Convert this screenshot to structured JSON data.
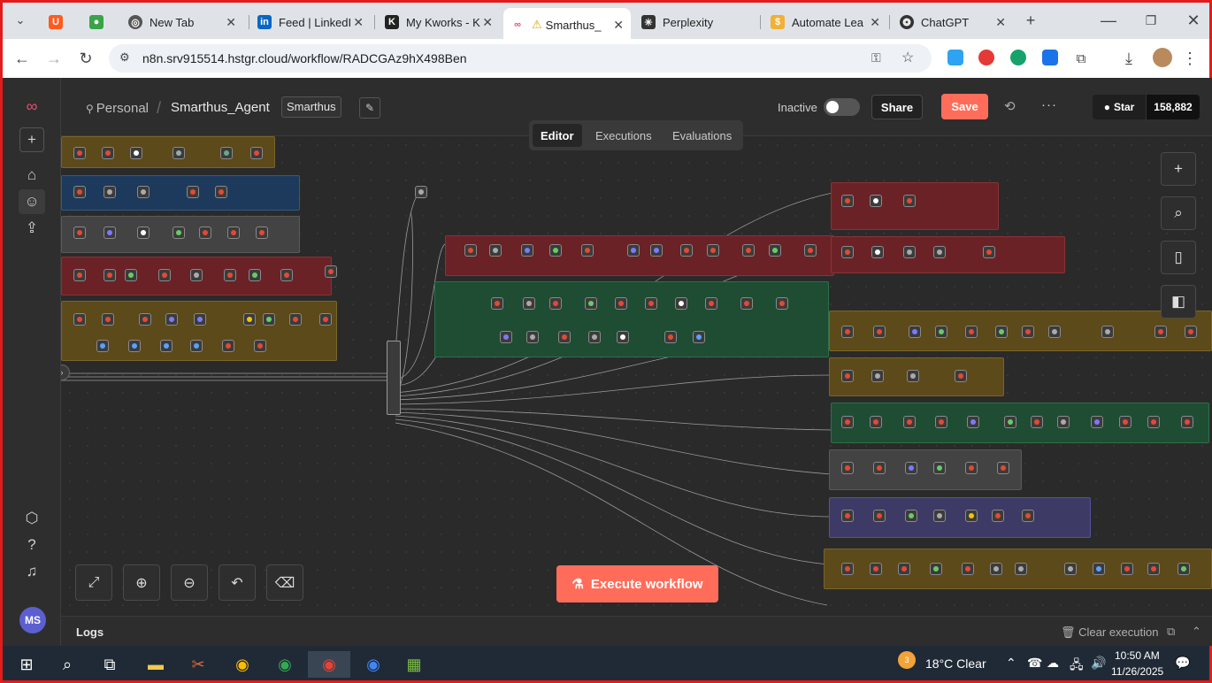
{
  "browser": {
    "tabs": [
      {
        "label": "",
        "icon": "ublock-icon"
      },
      {
        "label": "",
        "icon": "globe-icon"
      },
      {
        "label": "New Tab",
        "icon": "chrome-icon"
      },
      {
        "label": "Feed | LinkedI",
        "icon": "linkedin-icon"
      },
      {
        "label": "My Kworks - K",
        "icon": "kwork-icon"
      },
      {
        "label": "Smarthus_",
        "icon": "n8n-icon",
        "active": true
      },
      {
        "label": "Perplexity",
        "icon": "perplexity-icon"
      },
      {
        "label": "Automate Lea",
        "icon": "automation-icon"
      },
      {
        "label": "ChatGPT",
        "icon": "chatgpt-icon"
      }
    ],
    "url": "n8n.srv915514.hstgr.cloud/workflow/RADCGAz9hX498Ben"
  },
  "header": {
    "breadcrumb_home": "Personal",
    "separator": "/",
    "workflow_name": "Smarthus_Agent",
    "tag": "Smarthus",
    "status_label": "Inactive",
    "share_label": "Share",
    "save_label": "Save",
    "more_label": "···",
    "github_star_label": "Star",
    "github_star_count": "158,882"
  },
  "mode_tabs": [
    "Editor",
    "Executions",
    "Evaluations"
  ],
  "canvas": {
    "execute_label": "Execute workflow"
  },
  "logs": {
    "label": "Logs",
    "clear_label": "Clear execution"
  },
  "sidebar": {
    "avatar_initials": "MS"
  },
  "taskbar": {
    "weather": "18°C  Clear",
    "time": "10:50 AM",
    "date": "11/26/2025",
    "weather_badge": "3"
  },
  "colors": {
    "accent": "#ff6d5a",
    "group_brown": "#5c4a1a",
    "group_red": "#6b2226",
    "group_blue": "#1d3a5c",
    "group_green": "#1e4d33",
    "group_gray": "#434343",
    "group_purple": "#3e3a66"
  }
}
